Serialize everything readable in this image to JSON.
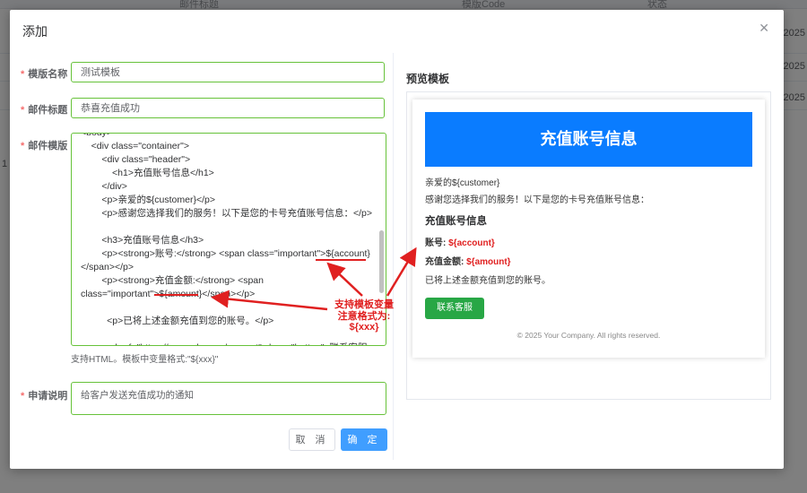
{
  "background": {
    "columns": [
      "邮件标题",
      "模版Code",
      "状态"
    ],
    "dates": [
      "2025",
      "2025",
      "2025"
    ],
    "left_value": "1"
  },
  "dialog": {
    "title": "添加",
    "close_icon": "close-icon"
  },
  "form": {
    "template_name": {
      "label": "模版名称",
      "value": "测试模板"
    },
    "mail_subject": {
      "label": "邮件标题",
      "value": "恭喜充值成功"
    },
    "mail_template": {
      "label": "邮件模版",
      "lines": [
        "<body>",
        "    <div class=\"container\">",
        "        <div class=\"header\">",
        "            <h1>充值账号信息</h1>",
        "        </div>",
        "        <p>亲爱的${customer}</p>",
        "        <p>感谢您选择我们的服务！以下是您的卡号充值账号信息：</p>",
        "",
        "        <h3>充值账号信息</h3>",
        "        <p><strong>账号:</strong> <span class=\"important\">${account}",
        "</span></p>",
        "        <p><strong>充值金额:</strong> <span",
        "class=\"important\">${amount}</span></p>",
        "",
        "          <p>已将上述金额充值到您的账号。</p>",
        "",
        "        <a href=\"https://example.com/support\" class=\"button\">联系客服"
      ],
      "hint": "支持HTML。模板中变量格式:\"${xxx}\""
    },
    "description": {
      "label": "申请说明",
      "value": "给客户发送充值成功的通知"
    },
    "cancel_label": "取 消",
    "ok_label": "确 定"
  },
  "preview": {
    "title": "预览模板",
    "header": "充值账号信息",
    "greeting": "亲爱的${customer}",
    "intro": "感谢您选择我们的服务！以下是您的卡号充值账号信息：",
    "section_title": "充值账号信息",
    "account_label": "账号:",
    "account_value": "${account}",
    "amount_label": "充值金额:",
    "amount_value": "${amount}",
    "done_text": "已将上述金额充值到您的账号。",
    "button_label": "联系客服",
    "footer": "© 2025 Your Company. All rights reserved.",
    "header_color": "#0a7cff",
    "button_color": "#28a745",
    "important_color": "#e02020"
  },
  "annotation": {
    "line1": "支持模板变量",
    "line2": "注意格式为:",
    "line3": "${xxx}",
    "color": "#e02020"
  }
}
